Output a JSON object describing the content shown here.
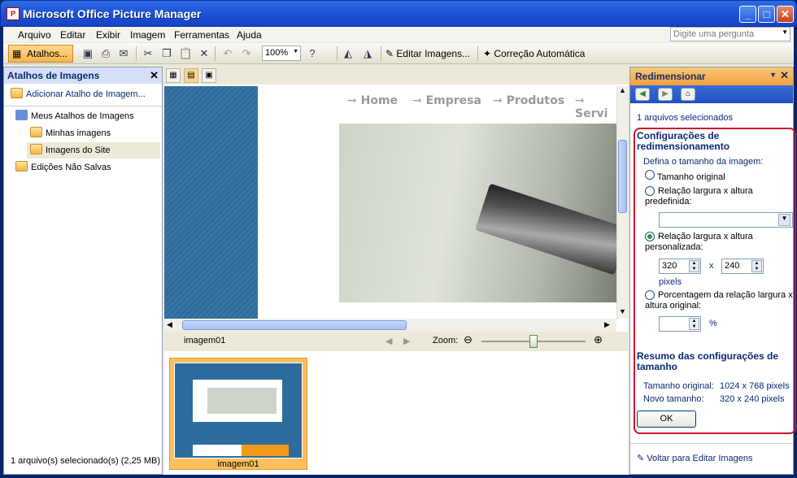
{
  "window": {
    "title": "Microsoft Office Picture Manager",
    "app_icon": "picture-manager-icon"
  },
  "menu": {
    "items": [
      "Arquivo",
      "Editar",
      "Exibir",
      "Imagem",
      "Ferramentas",
      "Ajuda"
    ],
    "ask_placeholder": "Digite uma pergunta"
  },
  "toolbar": {
    "atalhos": "Atalhos...",
    "zoom": "100%",
    "edit_images": "Editar Imagens...",
    "auto_correct": "Correção Automática"
  },
  "left_pane": {
    "title": "Atalhos de Imagens",
    "add_shortcut": "Adicionar Atalho de Imagem...",
    "tree": [
      "Meus Atalhos de Imagens",
      "Minhas imagens",
      "Imagens do Site",
      "Edições Não Salvas"
    ],
    "status": "1 arquivo(s) selecionado(s) (2,25 MB)"
  },
  "preview": {
    "nav": [
      "Home",
      "Empresa",
      "Produtos",
      "Servi"
    ],
    "filename": "imagem01",
    "zoom_label": "Zoom:",
    "zoom_level": 0.5
  },
  "film": {
    "thumb_label": "imagem01"
  },
  "resize": {
    "title": "Redimensionar",
    "selected": "1 arquivos selecionados",
    "section_title": "Configurações de redimensionamento",
    "define_label": "Defina o tamanho da imagem:",
    "opt_original": "Tamanho original",
    "opt_predef": "Relação largura x altura predefinida:",
    "opt_custom": "Relação largura x altura personalizada:",
    "width": "320",
    "x": "x",
    "height": "240",
    "pixels": "pixels",
    "opt_percent": "Porcentagem da relação largura x altura original:",
    "percent": "",
    "percent_unit": "%",
    "summary_title": "Resumo das configurações de tamanho",
    "orig_label": "Tamanho original:",
    "orig_value": "1024 x 768 pixels",
    "new_label": "Novo tamanho:",
    "new_value": "320 x 240 pixels",
    "ok": "OK",
    "back": "Voltar para Editar Imagens"
  }
}
